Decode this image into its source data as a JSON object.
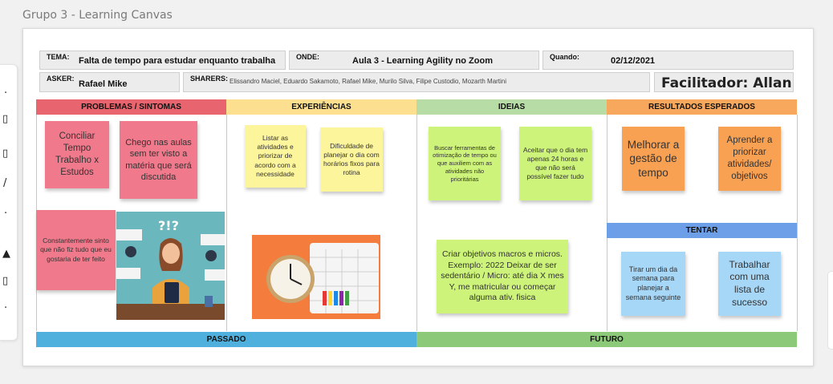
{
  "board_title": "Grupo 3 - Learning Canvas",
  "side_marks": [
    "·",
    "▯",
    "▯",
    "/",
    "·",
    "▲",
    "▯",
    "·"
  ],
  "header": {
    "tema_label": "TEMA:",
    "tema_value": "Falta de tempo para estudar enquanto trabalha",
    "onde_label": "ONDE:",
    "onde_value": "Aula 3 - Learning Agility no Zoom",
    "quando_label": "Quando:",
    "quando_value": "02/12/2021",
    "asker_label": "ASKER:",
    "asker_value": "Rafael Mike",
    "sharers_label": "SHARERS:",
    "sharers_value": "Elissandro Maciel, Eduardo Sakamoto, Rafael Mike, Murilo Silva, Filipe Custodio, Mozarth Martini",
    "facilitador": "Facilitador: Allan"
  },
  "columns": [
    {
      "title": "PROBLEMAS / SINTOMAS",
      "color": "#e8646e"
    },
    {
      "title": "EXPERIÊNCIAS",
      "color": "#fde08f"
    },
    {
      "title": "IDEIAS",
      "color": "#b7dca6"
    },
    {
      "title": "RESULTADOS ESPERADOS",
      "color": "#f8a85c"
    }
  ],
  "tentar": {
    "title": "TENTAR",
    "color": "#6d9ee8"
  },
  "bands": {
    "passado": {
      "label": "PASSADO",
      "color": "#4fb0dd"
    },
    "futuro": {
      "label": "FUTURO",
      "color": "#8cc979"
    }
  },
  "notes": {
    "p1": "Conciliar Tempo Trabalho x Estudos",
    "p2": "Chego nas aulas sem ter visto a matéria que será discutida",
    "p3": "Constantemente sinto que não fiz tudo que eu gostaria de ter feito",
    "e1": "Listar as atividades e priorizar de acordo com a necessidade",
    "e2": "Dificuldade de planejar o dia com horários fixos para rotina",
    "i1": "Buscar ferramentas de otimização de tempo ou que auxiliem com as atividades não prioritárias",
    "i2": "Aceitar que o dia tem apenas 24 horas e que não será possível fazer tudo",
    "i3": "Criar objetivos macros e micros. Exemplo: 2022 Deixar de ser sedentário / Micro: até dia X mes Y, me matricular ou começar alguma ativ. fisica",
    "r1": "Melhorar a gestão de tempo",
    "r2": "Aprender a priorizar atividades/ objetivos",
    "t1": "Tirar um dia da semana para planejar a semana seguinte",
    "t2": "Trabalhar com uma lista de sucesso"
  },
  "illustrations": {
    "stressed": "?!?",
    "stressed_alt": "stressed-woman-illustration",
    "clock_alt": "clock-and-calendar-photo"
  }
}
